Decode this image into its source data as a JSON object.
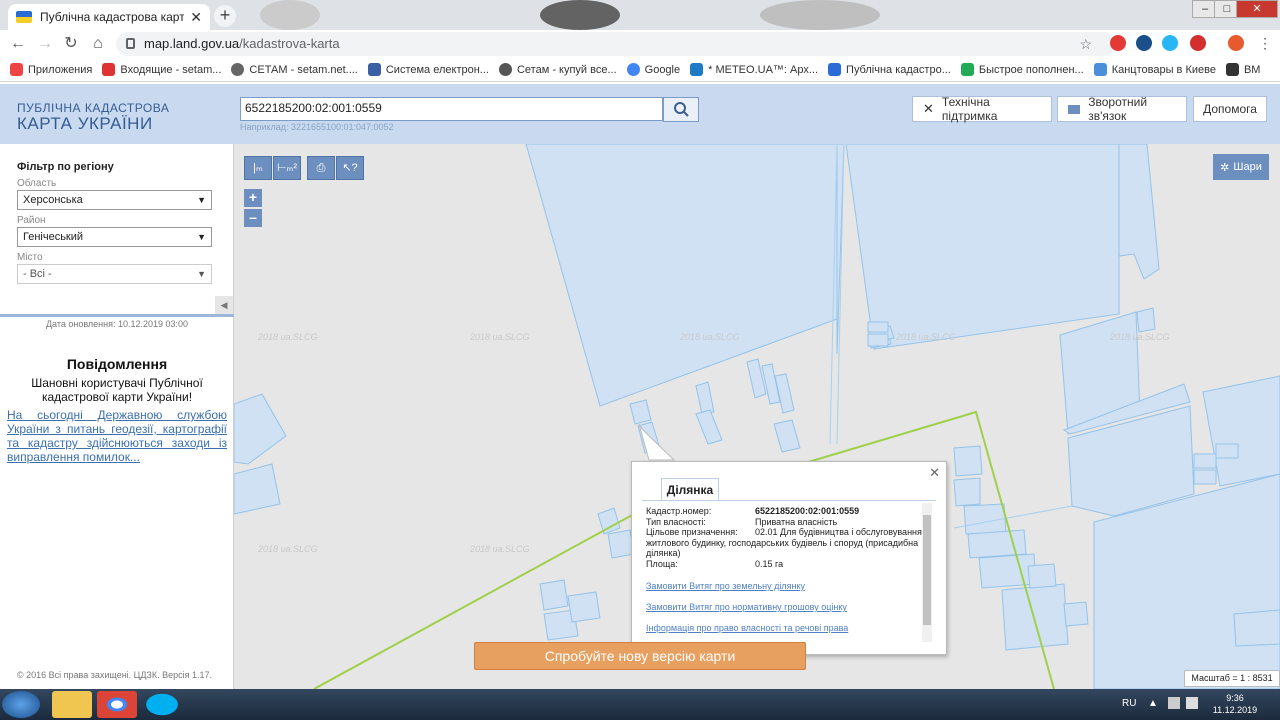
{
  "browser": {
    "tab_title": "Публічна кадастрова карта Укр",
    "url_host": "map.land.gov.ua",
    "url_path": "/kadastrova-karta",
    "bookmarks": [
      {
        "label": "Приложения",
        "color": "#e44"
      },
      {
        "label": "Входящие - setam...",
        "color": "#d33"
      },
      {
        "label": "СЕТАМ - setam.net....",
        "color": "#666"
      },
      {
        "label": "Система електрон...",
        "color": "#3a5fa5"
      },
      {
        "label": "Сетам - купуй все...",
        "color": "#555"
      },
      {
        "label": "Google",
        "color": "#4285f4"
      },
      {
        "label": "* METEO.UA™: Арх...",
        "color": "#1f7ac6"
      },
      {
        "label": "Публічна кадастро...",
        "color": "#2b6bd6"
      },
      {
        "label": "Быстрое пополнен...",
        "color": "#2a5"
      },
      {
        "label": "Канцтовары в Киеве",
        "color": "#4a90d9"
      },
      {
        "label": "BM",
        "color": "#333"
      }
    ]
  },
  "header": {
    "logo_line1": "ПУБЛІЧНА КАДАСТРОВА",
    "logo_line2": "КАРТА УКРАЇНИ",
    "search_value": "6522185200:02:001:0559",
    "search_hint": "Наприклад: 3221655100:01:047:0052",
    "buttons": {
      "support": "Технічна підтримка",
      "feedback": "Зворотний зв'язок",
      "help": "Допомога"
    }
  },
  "sidebar": {
    "filter_title": "Фільтр по регіону",
    "oblast_label": "Область",
    "oblast_value": "Херсонська",
    "rayon_label": "Район",
    "rayon_value": "Генічеський",
    "city_label": "Місто",
    "city_value": "- Всі -",
    "updated": "Дата оновлення: 10.12.2019 03:00",
    "notice_title": "Повідомлення",
    "notice_text": "Шановні користувачі Публічної кадастрової карти України!",
    "notice_link": "На сьогодні Державною службою України з питань геодезії, картографії та кадастру здійснюються заходи із виправлення помилок...",
    "copyright": "© 2016 Всі права захищені. ЦДЗК. Версія 1.17."
  },
  "map": {
    "layers_label": "Шари",
    "watermark": "2018 ua.SLCG",
    "scale": "Масштаб = 1 : 8531",
    "new_version": "Спробуйте нову версію карти",
    "popup": {
      "tab": "Ділянка",
      "cad_key": "Кадастр.номер:",
      "cad_val": "6522185200:02:001:0559",
      "own_key": "Тип власності:",
      "own_val": "Приватна власність",
      "purpose_key": "Цільове призначення:",
      "purpose_val": "02.01 Для будівництва і обслуговування житлового будинку, господарських будівель і споруд (присадибна ділянка)",
      "area_key": "Площа:",
      "area_val": "0.15 га",
      "link1": "Замовити Витяг про земельну ділянку",
      "link2": "Замовити Витяг про нормативну грошову оцінку",
      "link3": "Інформація про право власності та речові права"
    }
  },
  "taskbar": {
    "lang": "RU",
    "time": "9:36",
    "date": "11.12.2019"
  }
}
